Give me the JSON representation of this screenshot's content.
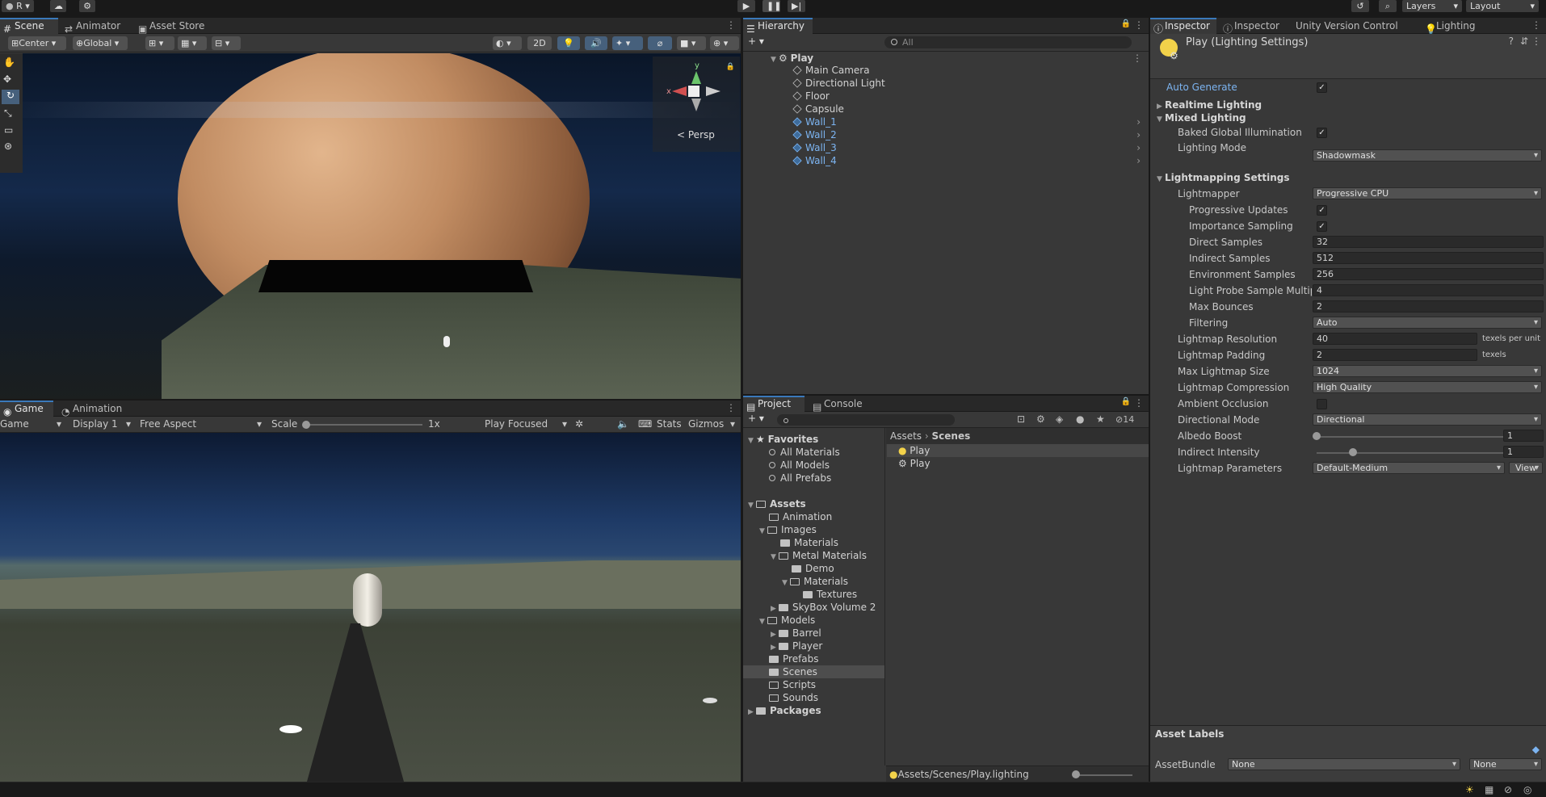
{
  "topbar": {
    "account": "R",
    "layers": "Layers",
    "layout": "Layout"
  },
  "scene": {
    "tabs": [
      "Scene",
      "Animator",
      "Asset Store"
    ],
    "pivot": "Center",
    "space": "Global",
    "mode2d": "2D",
    "persp": "Persp"
  },
  "game": {
    "tabs": [
      "Game",
      "Animation"
    ],
    "view": "Game",
    "display": "Display 1",
    "aspect": "Free Aspect",
    "scale_label": "Scale",
    "scale_value": "1x",
    "play_mode": "Play Focused",
    "stats": "Stats",
    "gizmos": "Gizmos"
  },
  "hierarchy": {
    "tab": "Hierarchy",
    "search_placeholder": "All",
    "scene": "Play",
    "items": [
      "Main Camera",
      "Directional Light",
      "Floor",
      "Capsule",
      "Wall_1",
      "Wall_2",
      "Wall_3",
      "Wall_4"
    ]
  },
  "project": {
    "tabs": [
      "Project",
      "Console"
    ],
    "hidden_count": "14",
    "favorites": "Favorites",
    "fav_items": [
      "All Materials",
      "All Models",
      "All Prefabs"
    ],
    "assets": "Assets",
    "tree": [
      "Animation",
      "Images",
      "Materials",
      "Metal Materials",
      "Demo",
      "Materials",
      "Textures",
      "SkyBox Volume 2",
      "Models",
      "Barrel",
      "Player",
      "Prefabs",
      "Scenes",
      "Scripts",
      "Sounds"
    ],
    "packages": "Packages",
    "breadcrumb_root": "Assets",
    "breadcrumb_current": "Scenes",
    "files": [
      "Play",
      "Play"
    ],
    "path": "Assets/Scenes/Play.lighting"
  },
  "inspector": {
    "tabs": [
      "Inspector",
      "Inspector",
      "Unity Version Control",
      "Lighting"
    ],
    "title": "Play (Lighting Settings)",
    "auto_generate": "Auto Generate",
    "realtime": "Realtime Lighting",
    "mixed": "Mixed Lighting",
    "baked_gi": "Baked Global Illumination",
    "lighting_mode": "Lighting Mode",
    "lighting_mode_value": "Shadowmask",
    "lightmapping": "Lightmapping Settings",
    "lightmapper": "Lightmapper",
    "lightmapper_value": "Progressive CPU",
    "progressive_updates": "Progressive Updates",
    "importance_sampling": "Importance Sampling",
    "direct_samples": "Direct Samples",
    "direct_samples_value": "32",
    "indirect_samples": "Indirect Samples",
    "indirect_samples_value": "512",
    "env_samples": "Environment Samples",
    "env_samples_value": "256",
    "probe_mult": "Light Probe Sample Multipl",
    "probe_mult_value": "4",
    "max_bounces": "Max Bounces",
    "max_bounces_value": "2",
    "filtering": "Filtering",
    "filtering_value": "Auto",
    "resolution": "Lightmap Resolution",
    "resolution_value": "40",
    "resolution_unit": "texels per unit",
    "padding": "Lightmap Padding",
    "padding_value": "2",
    "padding_unit": "texels",
    "max_size": "Max Lightmap Size",
    "max_size_value": "1024",
    "compression": "Lightmap Compression",
    "compression_value": "High Quality",
    "ao": "Ambient Occlusion",
    "dir_mode": "Directional Mode",
    "dir_mode_value": "Directional",
    "albedo": "Albedo Boost",
    "albedo_value": "1",
    "indirect": "Indirect Intensity",
    "indirect_value": "1",
    "params": "Lightmap Parameters",
    "params_value": "Default-Medium",
    "view": "View",
    "asset_labels": "Asset Labels",
    "asset_bundle": "AssetBundle",
    "bundle_value": "None",
    "bundle_variant": "None"
  },
  "colors": {
    "accent": "#3a79bb",
    "prefab": "#7cb4f1",
    "bg": "#383838"
  }
}
